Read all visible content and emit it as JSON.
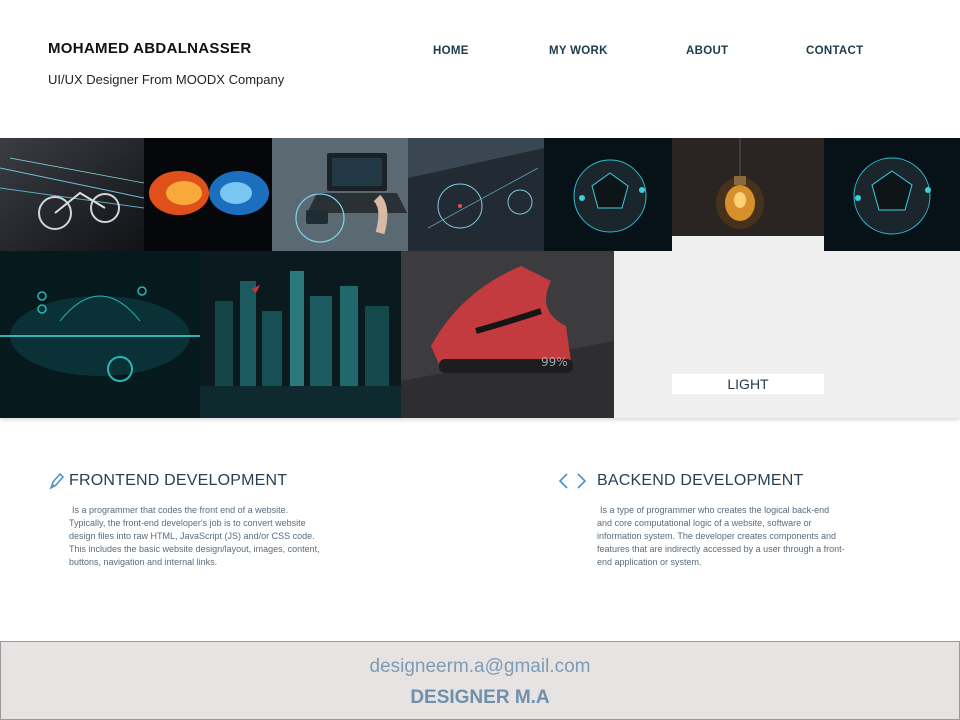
{
  "header": {
    "name": "MOHAMED ABDALNASSER",
    "subtitle": "UI/UX Designer From MOODX Company",
    "nav": [
      "HOME",
      "MY WORK",
      "ABOUT",
      "CONTACT"
    ]
  },
  "gallery": {
    "caption": "LIGHT"
  },
  "services": [
    {
      "title": "FRONTEND DEVELOPMENT",
      "icon": "pen-icon",
      "lines": [
        " Is a programmer that codes the front end of a website.",
        "Typically, the front-end developer's job is to convert website",
        "design files into raw HTML, JavaScript (JS) and/or CSS code.",
        "This includes the basic website design/layout, images, content,",
        "buttons, navigation and internal links."
      ]
    },
    {
      "title": "BACKEND DEVELOPMENT",
      "icon": "code-brackets-icon",
      "lines": [
        " Is a type of programmer who creates the logical back-end",
        "and core computational logic of a website, software or",
        "information system. The developer creates components and",
        "features that are indirectly accessed by a user through a front-",
        "end application or system."
      ]
    }
  ],
  "footer": {
    "email": "designeerm.a@gmail.com",
    "name": "DESIGNER M.A"
  },
  "colors": {
    "nav": "#1d3a4a",
    "title": "#2a3f55",
    "icon": "#4a8fc8",
    "footer_bg": "#e8e3e3",
    "footer_text": "#7e9bb4"
  }
}
